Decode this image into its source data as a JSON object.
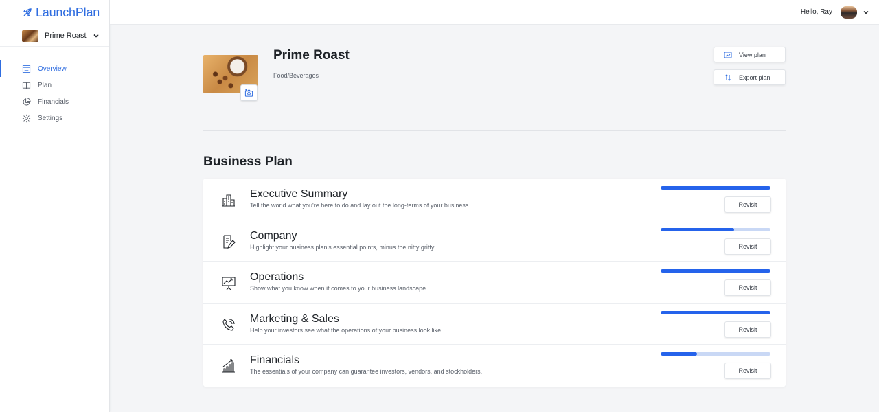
{
  "app": {
    "name": "LaunchPlan",
    "accent_color": "#2f6de0"
  },
  "sidebar": {
    "company_selector": {
      "label": "Prime Roast"
    },
    "items": [
      {
        "label": "Overview",
        "icon": "overview-icon",
        "active": true
      },
      {
        "label": "Plan",
        "icon": "book-icon",
        "active": false
      },
      {
        "label": "Financials",
        "icon": "pie-chart-icon",
        "active": false
      },
      {
        "label": "Settings",
        "icon": "gear-icon",
        "active": false
      }
    ]
  },
  "header": {
    "greeting": "Hello, Ray"
  },
  "company": {
    "name": "Prime Roast",
    "industry": "Food/Beverages",
    "actions": {
      "view_plan": "View plan",
      "export_plan": "Export plan"
    }
  },
  "business_plan": {
    "title": "Business Plan",
    "progress_color": "#2563eb",
    "sections": [
      {
        "title": "Executive Summary",
        "description": "Tell the world what you're here to do and lay out the long-terms of your business.",
        "icon": "building-icon",
        "progress": 1.0,
        "action": "Revisit"
      },
      {
        "title": "Company",
        "description": "Highlight your business plan's essential points, minus the nitty gritty.",
        "icon": "document-edit-icon",
        "progress": 0.67,
        "action": "Revisit"
      },
      {
        "title": "Operations",
        "description": "Show what you know when it comes to your business landscape.",
        "icon": "presentation-chart-icon",
        "progress": 1.0,
        "action": "Revisit"
      },
      {
        "title": "Marketing & Sales",
        "description": "Help your investors see what the operations of your business look like.",
        "icon": "phone-call-icon",
        "progress": 1.0,
        "action": "Revisit"
      },
      {
        "title": "Financials",
        "description": "The essentials of your company can guarantee investors, vendors, and stockholders.",
        "icon": "growth-chart-icon",
        "progress": 0.33,
        "action": "Revisit"
      }
    ]
  }
}
